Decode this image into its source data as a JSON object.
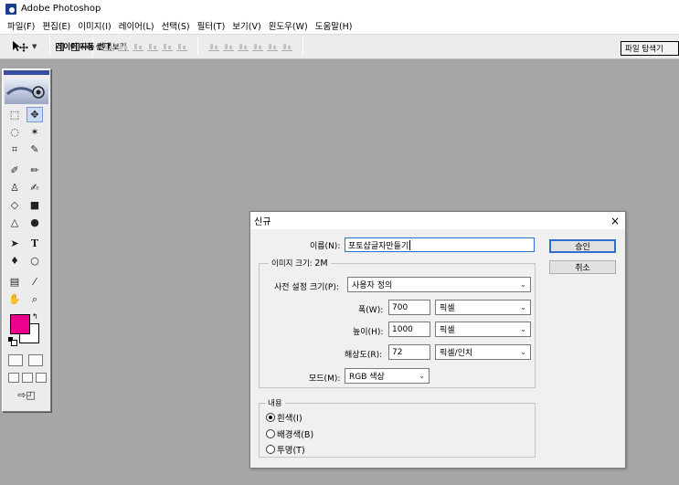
{
  "app": {
    "title": "Adobe Photoshop"
  },
  "menu": [
    "파일(F)",
    "편집(E)",
    "이미지(I)",
    "레이어(L)",
    "선택(S)",
    "필터(T)",
    "보기(V)",
    "윈도우(W)",
    "도움말(H)"
  ],
  "options_bar": {
    "auto_select_layer": "레이어 자동 선택",
    "show_bounding_box": "테두리 상자 보기",
    "file_browser": "파일 탐색기"
  },
  "toolbox": {
    "foreground_color": "#ec008c",
    "background_color": "#ffffff"
  },
  "dialog": {
    "title": "신규",
    "close_glyph": "×",
    "name_label": "이름(N):",
    "name_value": "포토샵글자만들기",
    "image_size_label": "이미지 크기:",
    "image_size_value": "2M",
    "preset_label": "사전 설정 크기(P):",
    "preset_value": "사용자 정의",
    "width_label": "폭(W):",
    "width_value": "700",
    "width_unit": "픽셀",
    "height_label": "높이(H):",
    "height_value": "1000",
    "height_unit": "픽셀",
    "resolution_label": "해상도(R):",
    "resolution_value": "72",
    "resolution_unit": "픽셀/인치",
    "mode_label": "모드(M):",
    "mode_value": "RGB 색상",
    "contents_legend": "내용",
    "contents_options": [
      "흰색(I)",
      "배경색(B)",
      "투명(T)"
    ],
    "contents_selected": "흰색(I)",
    "ok_label": "승인",
    "cancel_label": "취소"
  }
}
